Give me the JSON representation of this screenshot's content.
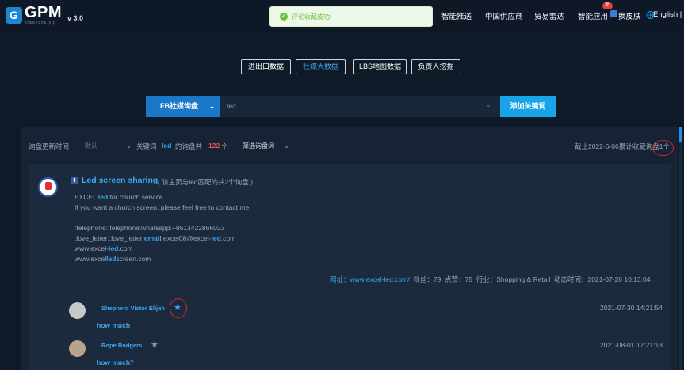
{
  "header": {
    "logo_mark": "G",
    "logo_text": "GPM",
    "logo_sub": "tradesns.vip",
    "version": "v 3.0",
    "toast": "评论收藏成功!",
    "nav": [
      "智能推送",
      "中国供应商",
      "贸易雷达",
      "智能应用"
    ],
    "badge": "新",
    "skin": "换皮肤",
    "language": "English |"
  },
  "tabs": [
    {
      "label": "进出口数据",
      "active": false
    },
    {
      "label": "社媒大数据",
      "active": true
    },
    {
      "label": "LBS地图数据",
      "active": false
    },
    {
      "label": "负责人挖掘",
      "active": false
    }
  ],
  "search": {
    "type": "FB社媒询盘",
    "value": "led",
    "add_button": "添加关键词"
  },
  "filter": {
    "time_label": "询盘更新时间",
    "time_value": "默认",
    "keyword_prefix": "关键词",
    "keyword": "led",
    "count_prefix": "的询盘共",
    "count": "122",
    "count_suffix": "个",
    "filter_label": "筛选询盘词",
    "total_note": "截止2022-6-06累计收藏询盘1个"
  },
  "post": {
    "title": "Led screen sharing",
    "note": "( 该主页与led匹配的共2个询盘 )",
    "lines": [
      [
        "EXCEL ",
        "led",
        " for church service"
      ],
      [
        "If you want a church screen, please feel free to contact me",
        "",
        ""
      ],
      [
        "",
        "",
        ""
      ],
      [
        ":telephone::telephone:whatsapp:+8613422866023",
        "",
        ""
      ],
      [
        ":love_letter::love_letter:",
        "email",
        ":excel08@excel-",
        "led",
        ".com"
      ],
      [
        "www.excel-",
        "led",
        ".com"
      ],
      [
        "www.excel",
        "led",
        "screen.com"
      ]
    ],
    "meta": {
      "website_label": "网址：",
      "website": "www.excel-led.com/",
      "fans": "粉丝：79",
      "likes": "点赞：75",
      "industry": "行业：Shopping & Retail",
      "time": "动态时间：2021-07-26 10:13:04"
    }
  },
  "comments": [
    {
      "name": "Shepherd Victor Elijah",
      "time": "2021-07-30 14:21:54",
      "text": "how much",
      "text_suffix": "",
      "starred": true
    },
    {
      "name": "Rope Rodgers",
      "time": "2021-08-01 17:21:13",
      "text": "how much",
      "text_suffix": "?",
      "starred": false
    }
  ],
  "colors": {
    "accent": "#3ea8f0",
    "count": "#f04b57",
    "star_active": "#3ea8f0",
    "star_inactive": "#8a96a8"
  }
}
